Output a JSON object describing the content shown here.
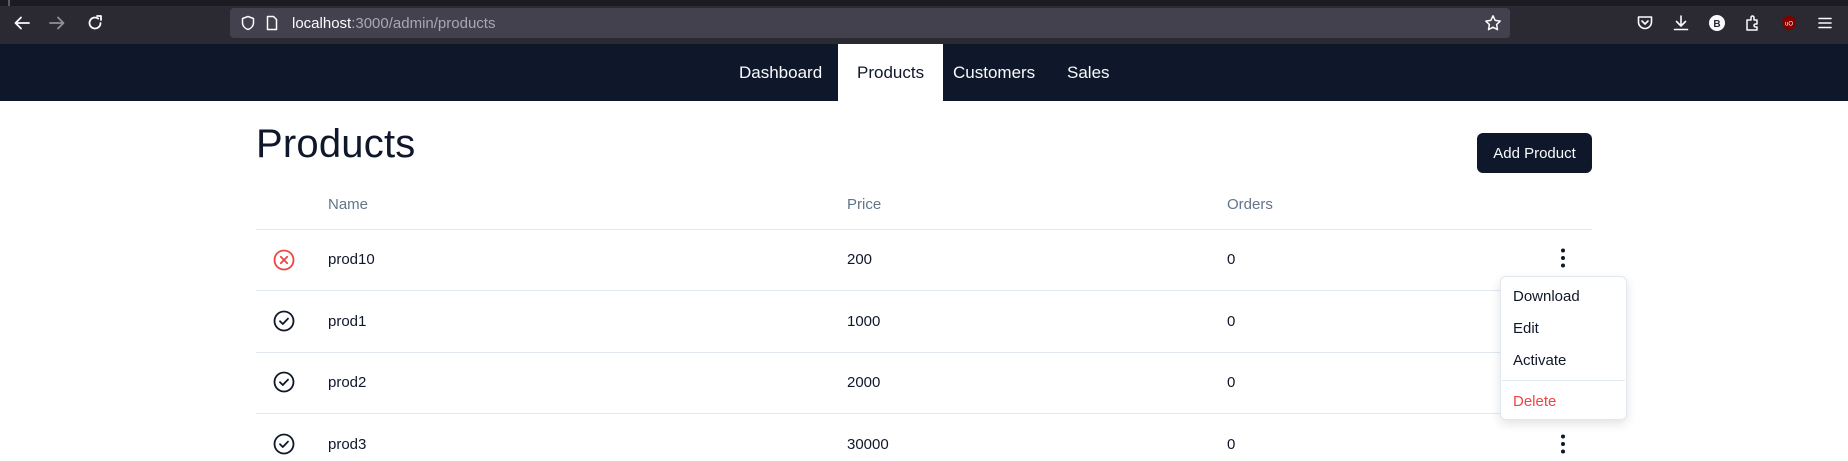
{
  "browser": {
    "url_host": "localhost",
    "url_rest": ":3000/admin/products"
  },
  "nav": {
    "items": [
      {
        "label": "Dashboard",
        "active": false
      },
      {
        "label": "Products",
        "active": true
      },
      {
        "label": "Customers",
        "active": false
      },
      {
        "label": "Sales",
        "active": false
      }
    ]
  },
  "page": {
    "title": "Products",
    "add_button": "Add Product"
  },
  "table": {
    "columns": [
      "Name",
      "Price",
      "Orders"
    ],
    "rows": [
      {
        "status": "inactive",
        "name": "prod10",
        "price": "200",
        "orders": "0"
      },
      {
        "status": "active",
        "name": "prod1",
        "price": "1000",
        "orders": "0"
      },
      {
        "status": "active",
        "name": "prod2",
        "price": "2000",
        "orders": "0"
      },
      {
        "status": "active",
        "name": "prod3",
        "price": "30000",
        "orders": "0"
      }
    ]
  },
  "row_menu": {
    "items": [
      "Download",
      "Edit",
      "Activate"
    ],
    "danger_item": "Delete"
  },
  "colors": {
    "nav_bg": "#0f172a",
    "danger": "#ef4444",
    "muted": "#64748b"
  }
}
